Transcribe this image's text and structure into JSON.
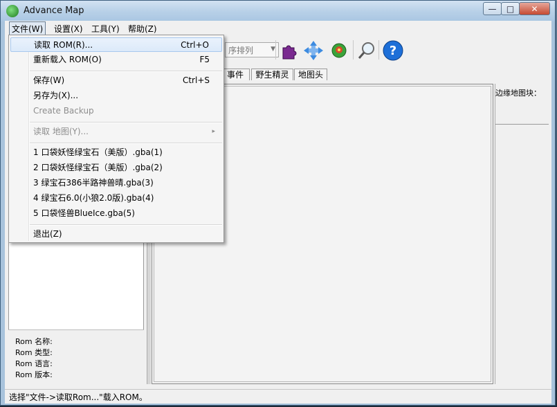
{
  "window": {
    "title": "Advance Map",
    "min_glyph": "—",
    "max_glyph": "□",
    "close_glyph": "✕"
  },
  "menubar": [
    "文件(W)",
    "设置(X)",
    "工具(Y)",
    "帮助(Z)"
  ],
  "toolbar": {
    "sort_combo": "序排列",
    "buttons": [
      "puzzle-icon",
      "move-arrows-icon",
      "eye-monster-icon",
      "magnifier-icon",
      "help-icon"
    ],
    "help_glyph": "?"
  },
  "tabs": [
    "事件",
    "野生精灵",
    "地图头"
  ],
  "right_panel": {
    "border_blocks_label": "边缘地图块："
  },
  "rom_info": {
    "name_label": "Rom 名称:",
    "type_label": "Rom 类型:",
    "language_label": "Rom 语言:",
    "version_label": "Rom 版本:"
  },
  "status_text": "选择\"文件->读取Rom...\"载入ROM。",
  "file_menu": {
    "items": [
      {
        "label": "读取 ROM(R)...",
        "shortcut": "Ctrl+O"
      },
      {
        "label": "重新载入 ROM(O)",
        "shortcut": "F5"
      },
      {
        "label": "保存(W)",
        "shortcut": "Ctrl+S"
      },
      {
        "label": "另存为(X)...",
        "shortcut": ""
      },
      {
        "label": "Create Backup",
        "shortcut": ""
      },
      {
        "label": "读取 地图(Y)...",
        "shortcut": ""
      },
      {
        "label": "1 口袋妖怪绿宝石（美版）.gba(1)",
        "shortcut": ""
      },
      {
        "label": "2 口袋妖怪绿宝石（美版）.gba(2)",
        "shortcut": ""
      },
      {
        "label": "3 绿宝石386半路神兽晴.gba(3)",
        "shortcut": ""
      },
      {
        "label": "4 绿宝石6.0(小狼2.0版).gba(4)",
        "shortcut": ""
      },
      {
        "label": "5 口袋怪兽BlueIce.gba(5)",
        "shortcut": ""
      },
      {
        "label": "退出(Z)",
        "shortcut": ""
      }
    ],
    "submenu_glyph": "▸"
  },
  "colors": {
    "accent": "#a8c8ee",
    "title_bar": "#b9d1e8",
    "close_button": "#c64a33"
  }
}
